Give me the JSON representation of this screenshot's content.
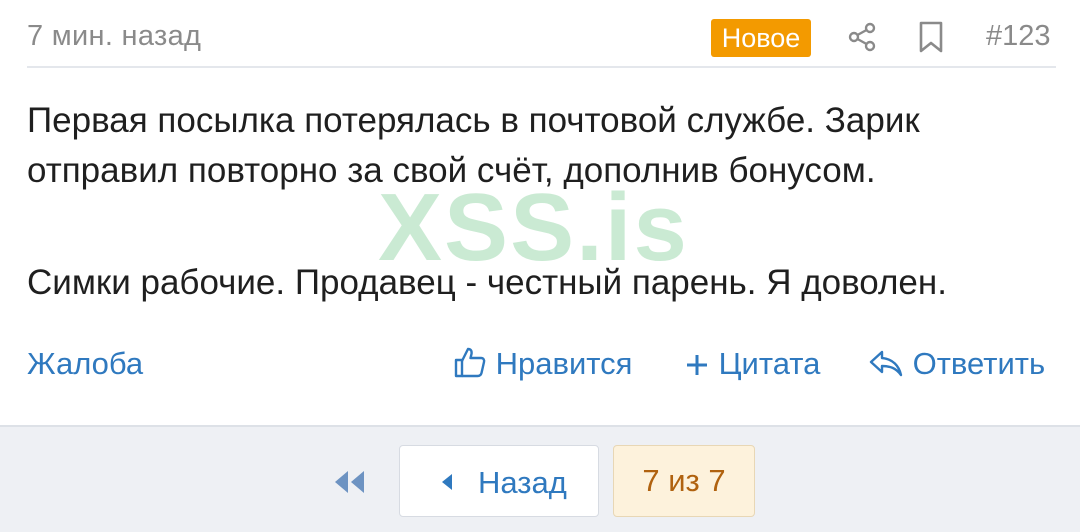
{
  "post": {
    "time": "7 мин. назад",
    "badge": "Новое",
    "number": "#123",
    "message": [
      "Первая посылка потерялась в почтовой службе. Зарик отправил повторно за свой счёт, дополнив бонусом.",
      "Симки рабочие. Продавец - честный парень. Я доволен."
    ],
    "watermark": "XSS.is",
    "actions": {
      "report": "Жалоба",
      "like": "Нравится",
      "quote": "Цитата",
      "reply": "Ответить"
    }
  },
  "pagination": {
    "back_label": "Назад",
    "page_indicator": "7 из 7"
  },
  "colors": {
    "accent": "#2f79bf",
    "badge": "#f39a00",
    "footer_bg": "#eef0f4",
    "page_indicator_bg": "#fdf2dc"
  },
  "icons": [
    "share-icon",
    "bookmark-icon",
    "thumbs-up-icon",
    "plus-icon",
    "reply-icon",
    "double-chevron-left-icon",
    "triangle-left-icon"
  ]
}
